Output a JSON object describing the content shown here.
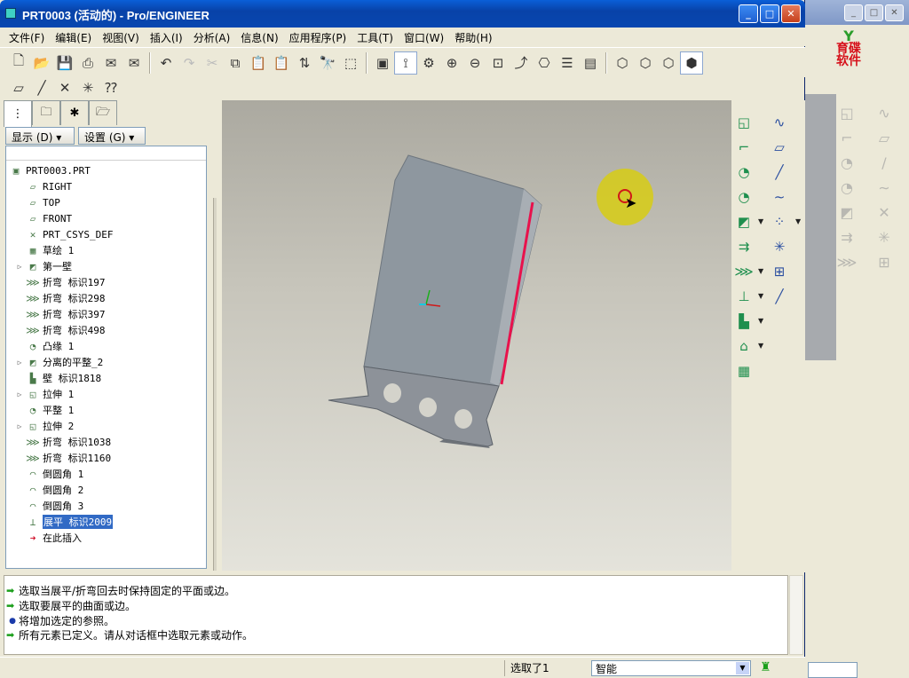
{
  "window": {
    "title": "PRT0003 (活动的) - Pro/ENGINEER"
  },
  "menu": [
    "文件(F)",
    "编辑(E)",
    "视图(V)",
    "插入(I)",
    "分析(A)",
    "信息(N)",
    "应用程序(P)",
    "工具(T)",
    "窗口(W)",
    "帮助(H)"
  ],
  "navigator": {
    "show_label": "显示 (D) ▾",
    "settings_label": "设置 (G) ▾",
    "tree": [
      {
        "label": "PRT0003.PRT",
        "icon": "part-icon",
        "glyph": "▣",
        "expandable": false,
        "indent": 0
      },
      {
        "label": "RIGHT",
        "icon": "datum-plane-icon",
        "glyph": "▱",
        "expandable": false,
        "indent": 1
      },
      {
        "label": "TOP",
        "icon": "datum-plane-icon",
        "glyph": "▱",
        "expandable": false,
        "indent": 1
      },
      {
        "label": "FRONT",
        "icon": "datum-plane-icon",
        "glyph": "▱",
        "expandable": false,
        "indent": 1
      },
      {
        "label": "PRT_CSYS_DEF",
        "icon": "csys-icon",
        "glyph": "✕",
        "expandable": false,
        "indent": 1
      },
      {
        "label": "草绘 1",
        "icon": "sketch-icon",
        "glyph": "▦",
        "expandable": false,
        "indent": 1
      },
      {
        "label": "第一壁",
        "icon": "first-wall-icon",
        "glyph": "◩",
        "expandable": true,
        "indent": 1
      },
      {
        "label": "折弯 标识197",
        "icon": "bend-icon",
        "glyph": "⋙",
        "expandable": false,
        "indent": 1
      },
      {
        "label": "折弯 标识298",
        "icon": "bend-icon",
        "glyph": "⋙",
        "expandable": false,
        "indent": 1
      },
      {
        "label": "折弯 标识397",
        "icon": "bend-icon",
        "glyph": "⋙",
        "expandable": false,
        "indent": 1
      },
      {
        "label": "折弯 标识498",
        "icon": "bend-icon",
        "glyph": "⋙",
        "expandable": false,
        "indent": 1
      },
      {
        "label": "凸缘 1",
        "icon": "flange-icon",
        "glyph": "◔",
        "expandable": false,
        "indent": 1
      },
      {
        "label": "分离的平整_2",
        "icon": "unattached-flat-icon",
        "glyph": "◩",
        "expandable": true,
        "indent": 1
      },
      {
        "label": "壁 标识1818",
        "icon": "wall-icon",
        "glyph": "▙",
        "expandable": false,
        "indent": 1
      },
      {
        "label": "拉伸 1",
        "icon": "extrude-icon",
        "glyph": "◱",
        "expandable": true,
        "indent": 1
      },
      {
        "label": "平整 1",
        "icon": "flat-icon",
        "glyph": "◔",
        "expandable": false,
        "indent": 1
      },
      {
        "label": "拉伸 2",
        "icon": "extrude-icon",
        "glyph": "◱",
        "expandable": true,
        "indent": 1
      },
      {
        "label": "折弯 标识1038",
        "icon": "bend-icon",
        "glyph": "⋙",
        "expandable": false,
        "indent": 1
      },
      {
        "label": "折弯 标识1160",
        "icon": "bend-icon",
        "glyph": "⋙",
        "expandable": false,
        "indent": 1
      },
      {
        "label": "倒圆角 1",
        "icon": "round-icon",
        "glyph": "◠",
        "expandable": false,
        "indent": 1
      },
      {
        "label": "倒圆角 2",
        "icon": "round-icon",
        "glyph": "◠",
        "expandable": false,
        "indent": 1
      },
      {
        "label": "倒圆角 3",
        "icon": "round-icon",
        "glyph": "◠",
        "expandable": false,
        "indent": 1
      },
      {
        "label": "展平 标识2009",
        "icon": "unbend-icon",
        "glyph": "⊥",
        "expandable": false,
        "indent": 1,
        "selected": true
      },
      {
        "label": "在此插入",
        "icon": "insert-here-icon",
        "glyph": "➜",
        "expandable": false,
        "indent": 1
      }
    ]
  },
  "messages": [
    {
      "text": "选取当展平/折弯回去时保持固定的平面或边。",
      "type": "prompt"
    },
    {
      "text": "选取要展平的曲面或边。",
      "type": "prompt"
    },
    {
      "text": "将增加选定的参照。",
      "type": "info"
    },
    {
      "text": "所有元素已定义。请从对话框中选取元素或动作。",
      "type": "prompt"
    }
  ],
  "status": {
    "selected": "选取了1",
    "filter_value": "智能"
  },
  "background_window": {
    "logo_line1": "育碟",
    "logo_line2": "软件"
  },
  "colors": {
    "title_blue": "#0a5fd8",
    "edge_highlight": "#e8124c",
    "cursor_halo": "#d7cd14",
    "part_gray": "#8e979f"
  }
}
